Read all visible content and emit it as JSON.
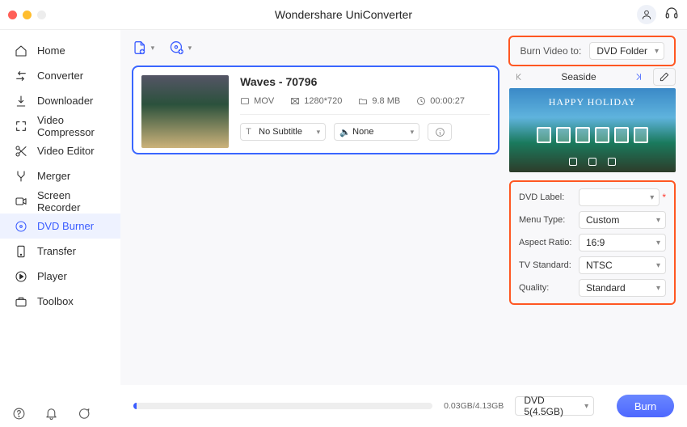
{
  "window": {
    "title": "Wondershare UniConverter"
  },
  "sidebar": {
    "items": [
      {
        "label": "Home"
      },
      {
        "label": "Converter"
      },
      {
        "label": "Downloader"
      },
      {
        "label": "Video Compressor"
      },
      {
        "label": "Video Editor"
      },
      {
        "label": "Merger"
      },
      {
        "label": "Screen Recorder"
      },
      {
        "label": "DVD Burner"
      },
      {
        "label": "Transfer"
      },
      {
        "label": "Player"
      },
      {
        "label": "Toolbox"
      }
    ]
  },
  "burn_to": {
    "label": "Burn Video to:",
    "value": "DVD Folder"
  },
  "clip": {
    "title": "Waves - 70796",
    "format": "MOV",
    "resolution": "1280*720",
    "size": "9.8 MB",
    "duration": "00:00:27",
    "subtitle": "No Subtitle",
    "audio": "None"
  },
  "theme": {
    "name": "Seaside",
    "banner_text": "HAPPY HOLIDAY"
  },
  "settings": {
    "dvd_label": {
      "label": "DVD Label:",
      "value": ""
    },
    "menu_type": {
      "label": "Menu Type:",
      "value": "Custom"
    },
    "aspect_ratio": {
      "label": "Aspect Ratio:",
      "value": "16:9"
    },
    "tv_standard": {
      "label": "TV Standard:",
      "value": "NTSC"
    },
    "quality": {
      "label": "Quality:",
      "value": "Standard"
    }
  },
  "progress": {
    "text": "0.03GB/4.13GB"
  },
  "disc": {
    "value": "DVD 5(4.5GB)"
  },
  "burn_button": "Burn"
}
